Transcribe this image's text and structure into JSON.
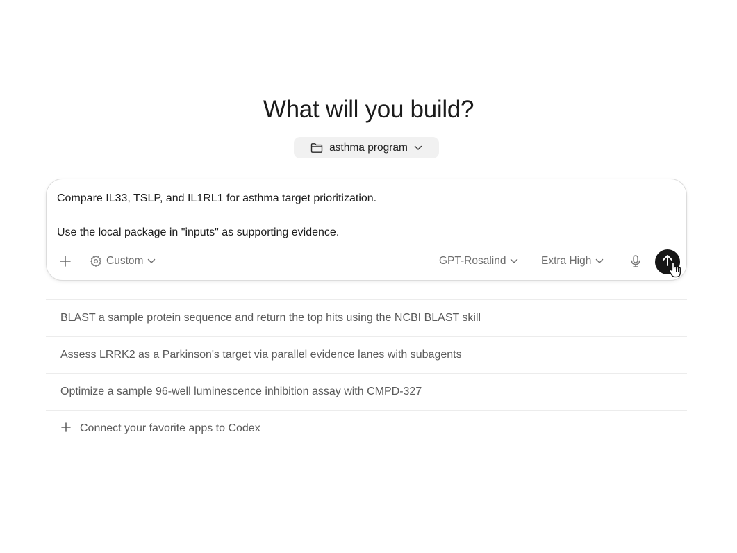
{
  "heading": "What will you build?",
  "project": {
    "name": "asthma program",
    "icon": "folder-icon"
  },
  "composer": {
    "prompt_line_1": "Compare IL33, TSLP, and IL1RL1 for asthma target prioritization.",
    "prompt_line_2": "Use the local package in \"inputs\" as supporting evidence.",
    "mode_label": "Custom",
    "model_label": "GPT-Rosalind",
    "effort_label": "Extra High"
  },
  "suggestions": [
    {
      "label": "BLAST a sample protein sequence and return the top hits using the NCBI BLAST skill"
    },
    {
      "label": "Assess LRRK2 as a Parkinson's target via parallel evidence lanes with subagents"
    },
    {
      "label": "Optimize a sample 96-well luminescence inhibition assay with CMPD-327"
    }
  ],
  "connect_apps_label": "Connect your favorite apps to Codex",
  "colors": {
    "send_button": "#161616",
    "pill_background": "#f1f1f1",
    "muted_text": "#6f6f6f"
  }
}
